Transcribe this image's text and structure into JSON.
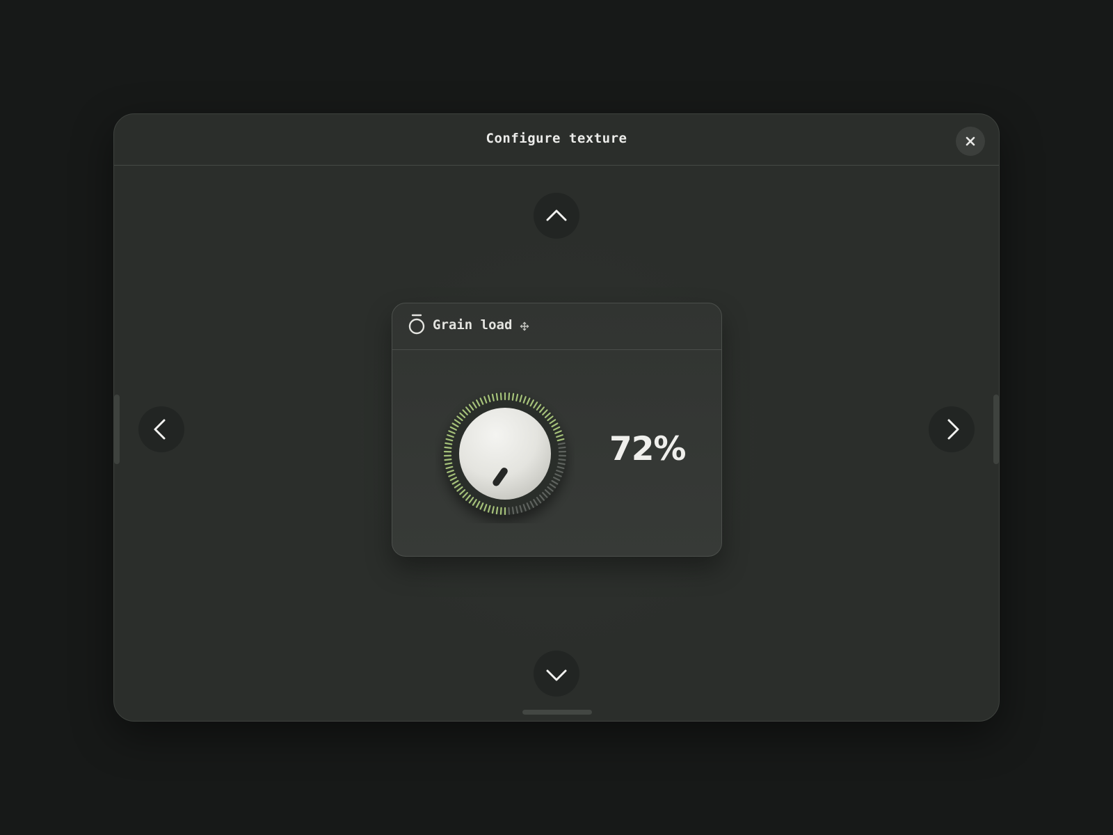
{
  "window": {
    "title": "Configure texture"
  },
  "icons": {
    "close": "close-icon",
    "up": "chevron-up-icon",
    "down": "chevron-down-icon",
    "left": "chevron-left-icon",
    "right": "chevron-right-icon",
    "card": "timer-icon",
    "drag": "move-icon"
  },
  "control": {
    "label": "Grain load",
    "value": 72,
    "value_text": "72%",
    "min": 0,
    "max": 100
  },
  "colors": {
    "background": "#171918",
    "window": "#2b2e2b",
    "card": "#343734",
    "accent": "#a6c27a",
    "inactive_ticks": "#5e625e",
    "text": "#ececea"
  }
}
